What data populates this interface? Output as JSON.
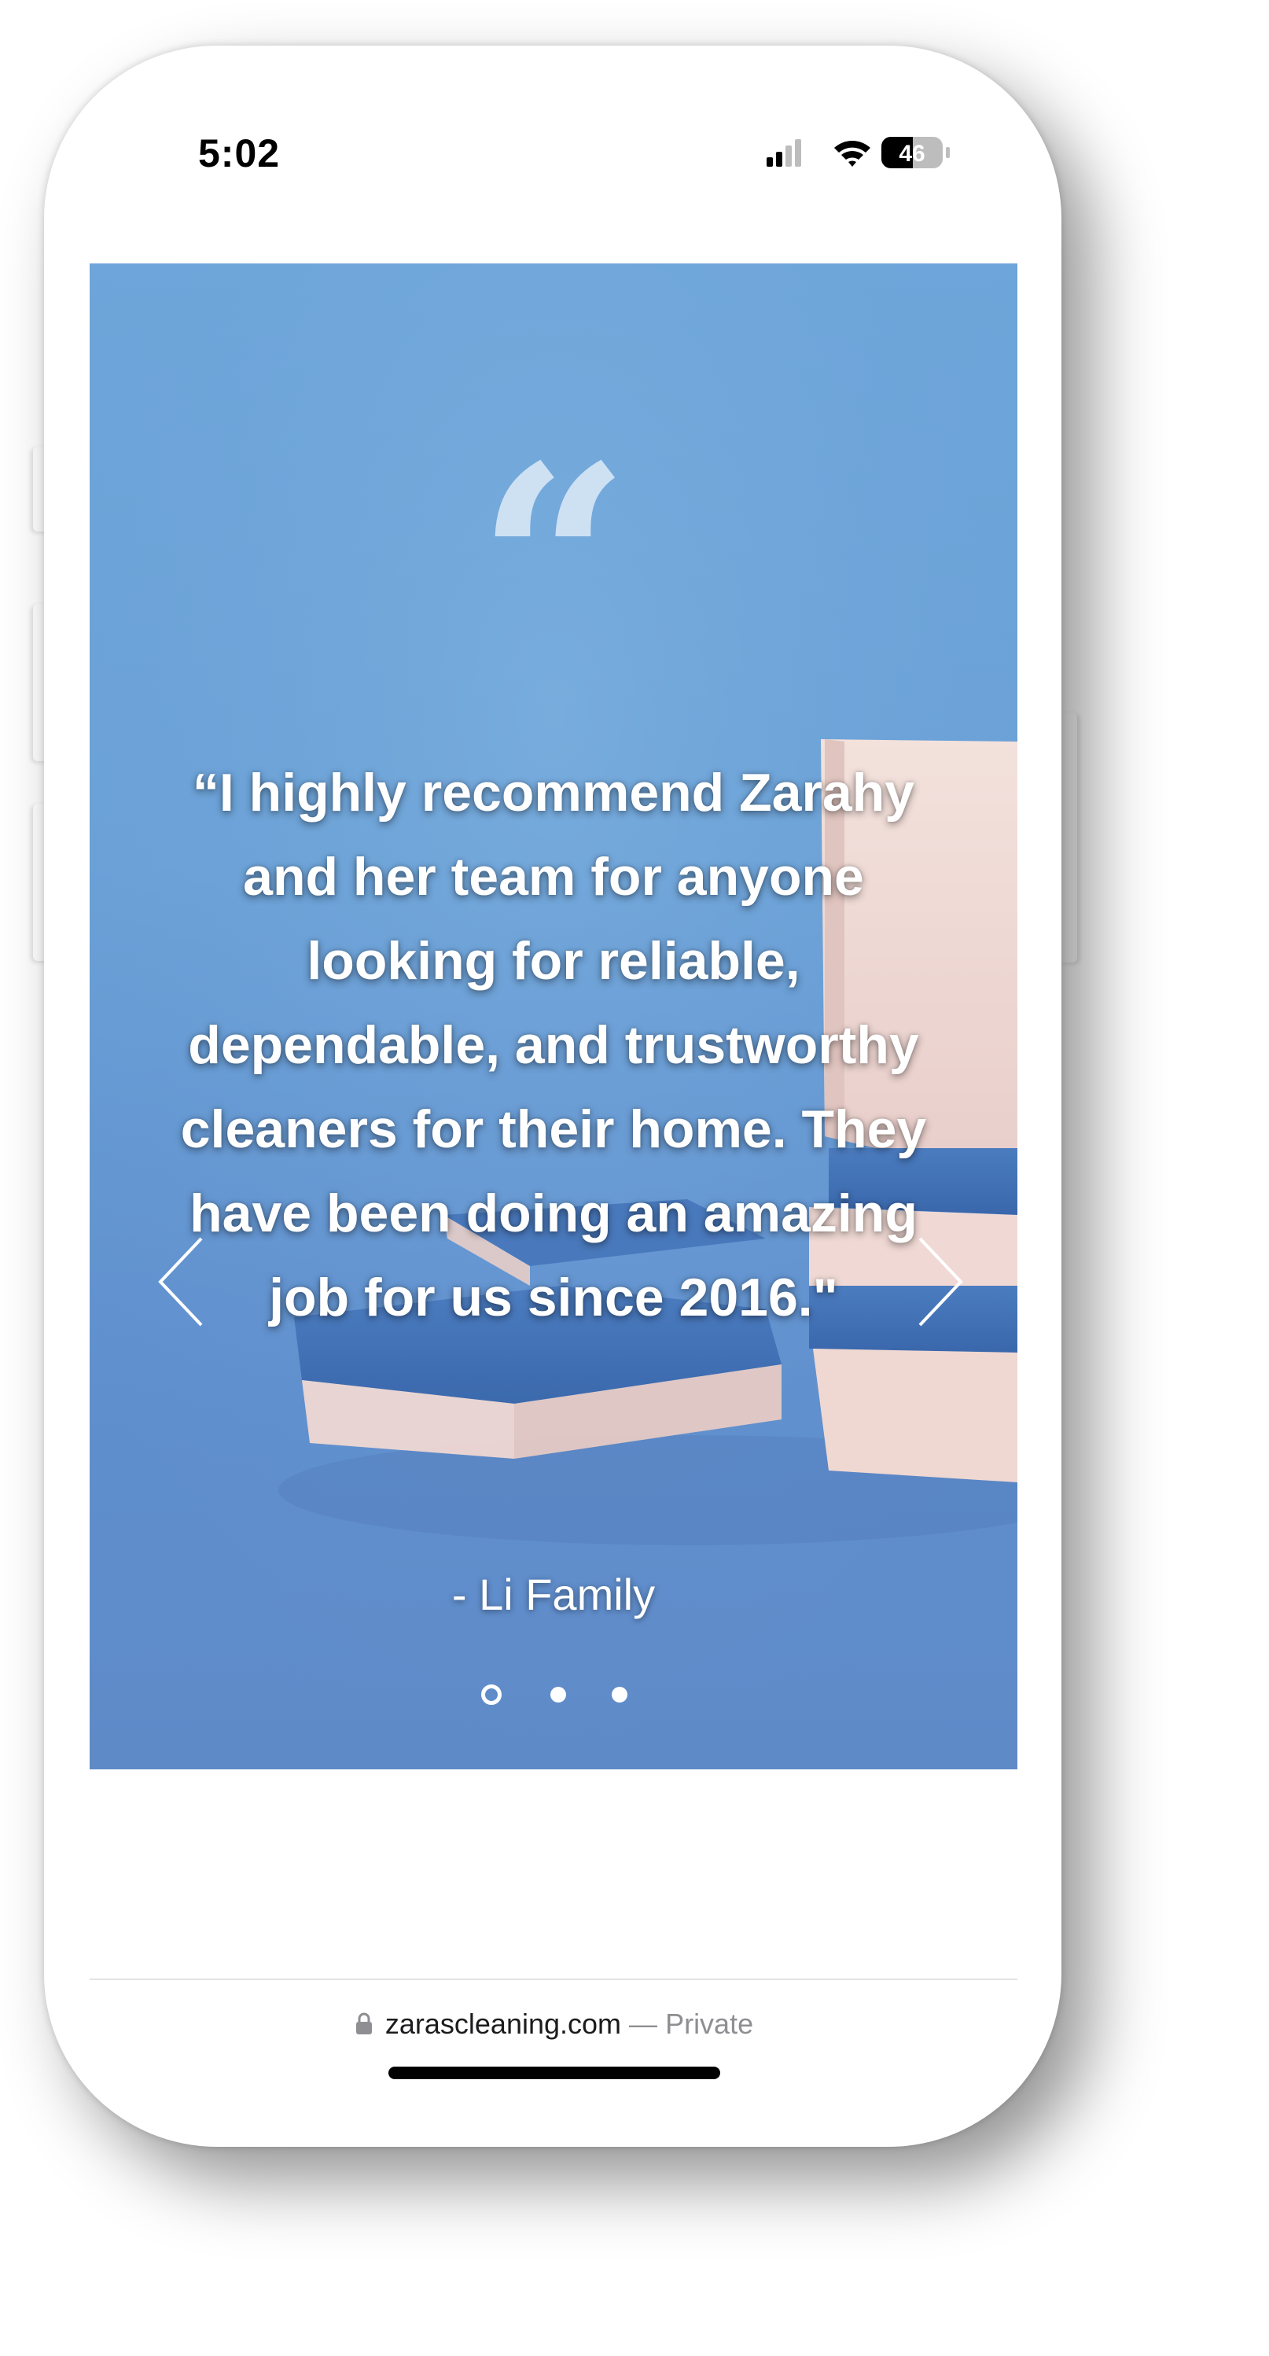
{
  "status_bar": {
    "time": "5:02",
    "battery_level": "46",
    "icons": [
      "cellular-signal-icon",
      "wifi-icon",
      "battery-icon"
    ]
  },
  "testimonial": {
    "quote_icon": "“",
    "quote": "“I highly recommend Zarahy and her team for anyone looking for reliable, dependable, and trustworthy cleaners for their home.  They have been doing an amazing job for us since 2016.\"",
    "author": "- Li Family",
    "prev_icon": "chevron-left-icon",
    "next_icon": "chevron-right-icon",
    "slides": {
      "count": 3,
      "active_index": 0
    }
  },
  "browser": {
    "domain": "zarascleaning.com",
    "separator": "—",
    "mode": "Private"
  },
  "colors": {
    "hero_blue": "#6aa2d8",
    "sponge_white": "#f2dcd8",
    "sponge_blue": "#3f6fb4",
    "text_white": "#ffffff"
  }
}
